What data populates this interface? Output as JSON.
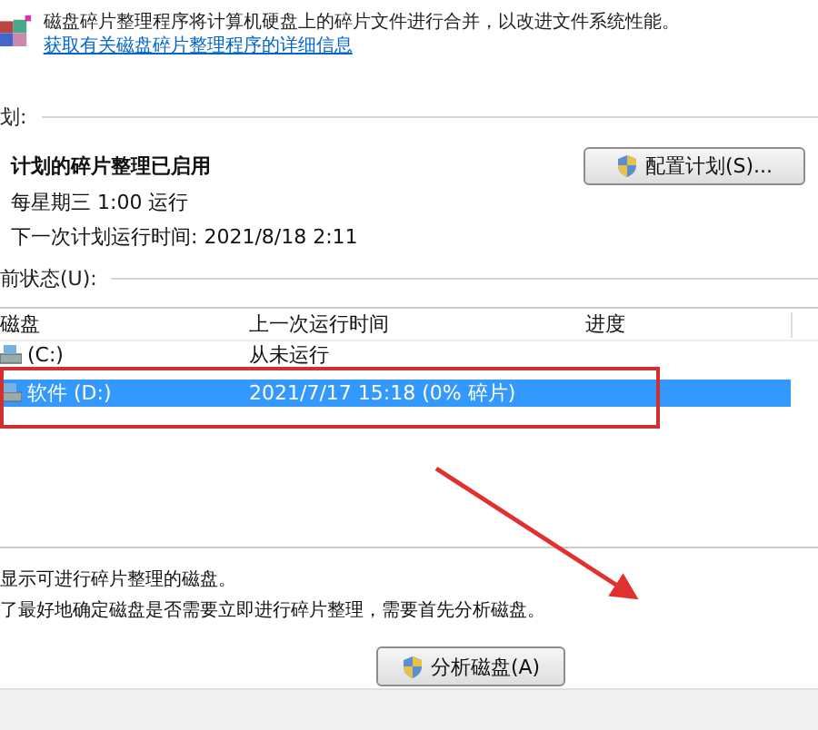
{
  "description": {
    "text": "磁盘碎片整理程序将计算机硬盘上的碎片文件进行合并，以改进文件系统性能。",
    "link": "获取有关磁盘碎片整理程序的详细信息"
  },
  "schedule": {
    "heading": "划:",
    "status": "计划的碎片整理已启用",
    "run": "每星期三  1:00 运行",
    "next_run": "下一次计划运行时间: 2021/8/18 2:11",
    "button": "配置计划(S)..."
  },
  "current_status": {
    "heading": "前状态(U):",
    "columns": [
      "磁盘",
      "上一次运行时间",
      "进度"
    ],
    "rows": [
      {
        "disk": "(C:)",
        "last_run": "从未运行",
        "selected": false
      },
      {
        "disk": "软件 (D:)",
        "last_run": "2021/7/17 15:18 (0% 碎片)",
        "selected": true
      }
    ]
  },
  "notes": [
    "显示可进行碎片整理的磁盘。",
    "了最好地确定磁盘是否需要立即进行碎片整理，需要首先分析磁盘。"
  ],
  "buttons": [
    "分析磁盘(A)"
  ],
  "annotations": {
    "highlight_box": true,
    "arrow": true
  }
}
